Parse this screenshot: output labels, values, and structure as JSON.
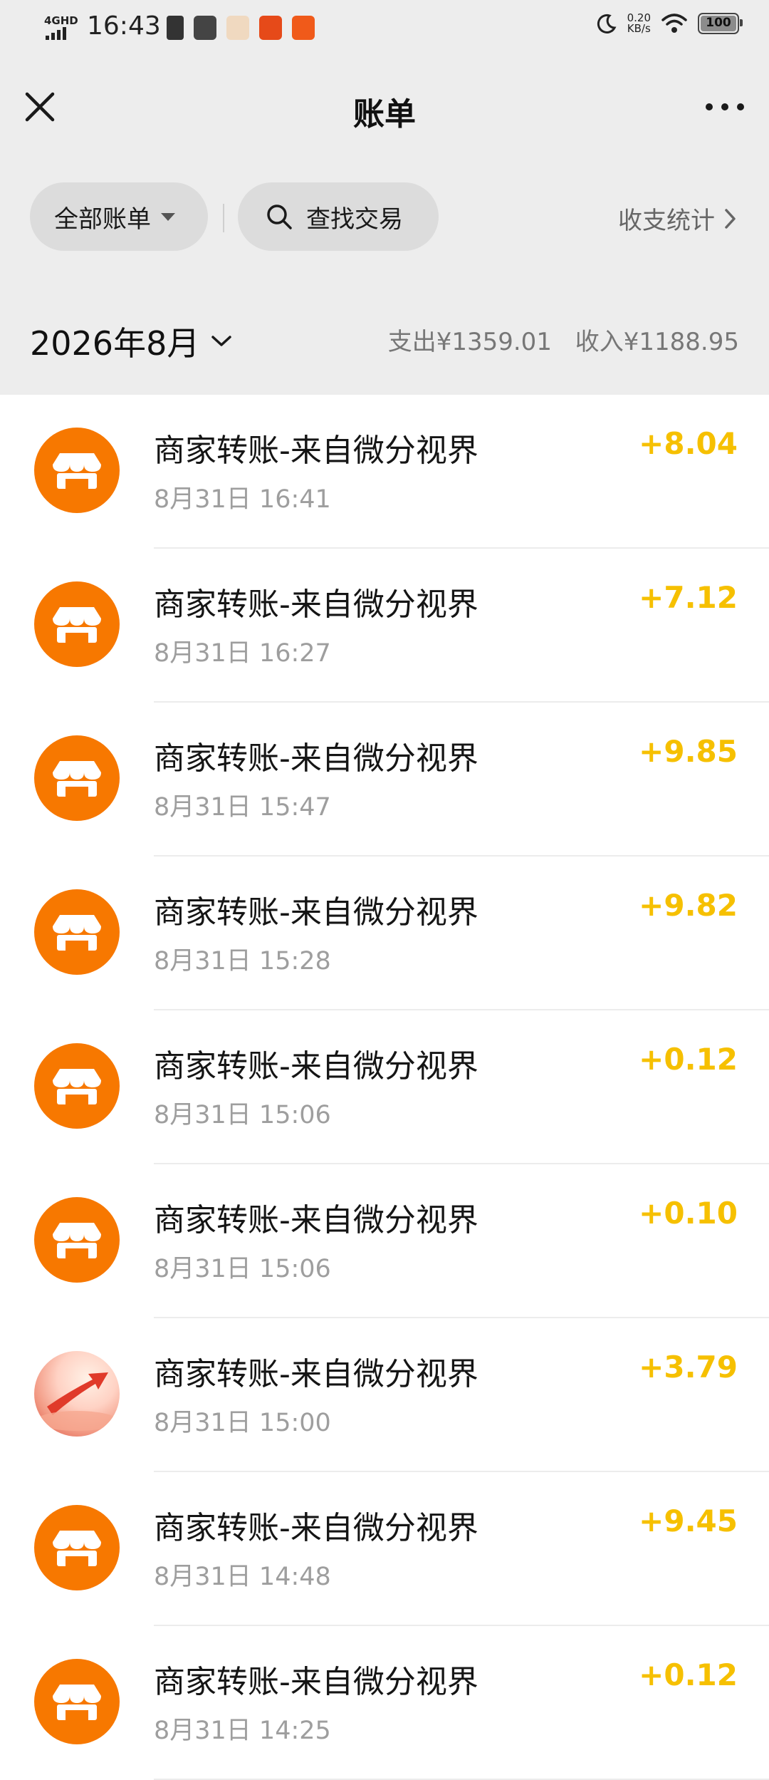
{
  "status_bar": {
    "network": "4GHD",
    "time": "16:43",
    "speed_value": "0.20",
    "speed_unit": "KB/s",
    "battery": "100"
  },
  "nav": {
    "title": "账单",
    "close_icon": "close-icon",
    "more_icon": "more-dots-icon"
  },
  "filters": {
    "all_bills": "全部账单",
    "search": "查找交易",
    "stats": "收支统计"
  },
  "summary": {
    "month": "2026年8月",
    "expense": "支出¥1359.01",
    "income": "收入¥1188.95"
  },
  "transactions": [
    {
      "title": "商家转账-来自微分视界",
      "time": "8月31日 16:41",
      "amount": "+8.04",
      "avatar": "store"
    },
    {
      "title": "商家转账-来自微分视界",
      "time": "8月31日 16:27",
      "amount": "+7.12",
      "avatar": "store"
    },
    {
      "title": "商家转账-来自微分视界",
      "time": "8月31日 15:47",
      "amount": "+9.85",
      "avatar": "store"
    },
    {
      "title": "商家转账-来自微分视界",
      "time": "8月31日 15:28",
      "amount": "+9.82",
      "avatar": "store"
    },
    {
      "title": "商家转账-来自微分视界",
      "time": "8月31日 15:06",
      "amount": "+0.12",
      "avatar": "store"
    },
    {
      "title": "商家转账-来自微分视界",
      "time": "8月31日 15:06",
      "amount": "+0.10",
      "avatar": "store"
    },
    {
      "title": "商家转账-来自微分视界",
      "time": "8月31日 15:00",
      "amount": "+3.79",
      "avatar": "photo"
    },
    {
      "title": "商家转账-来自微分视界",
      "time": "8月31日 14:48",
      "amount": "+9.45",
      "avatar": "store"
    },
    {
      "title": "商家转账-来自微分视界",
      "time": "8月31日 14:25",
      "amount": "+0.12",
      "avatar": "store"
    }
  ],
  "colors": {
    "income": "#f6c000",
    "store_avatar": "#f77800",
    "top_background": "#ededed"
  }
}
